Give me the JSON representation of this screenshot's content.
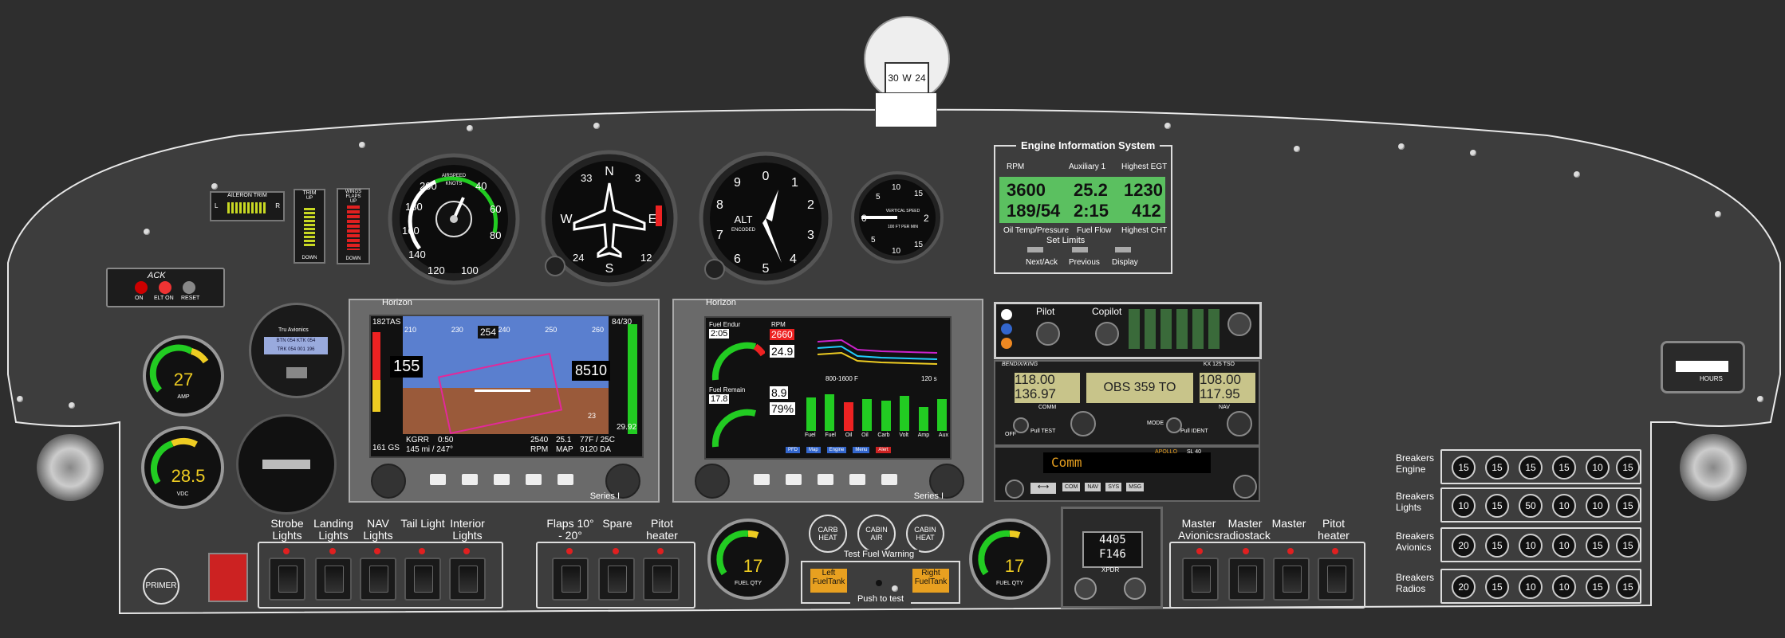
{
  "compass": {
    "labels": [
      "30",
      "W",
      "24"
    ]
  },
  "trim": {
    "aileron_label": "AILERON TRIM",
    "aileron_left": "L",
    "aileron_right": "R",
    "trim_label": "TRIM",
    "trim_up": "UP",
    "trim_down": "DOWN",
    "flaps_label": "WINGS FLAPS",
    "flaps_up": "UP",
    "flaps_down": "DOWN"
  },
  "elt": {
    "title": "ACK",
    "on": "ON",
    "elt_on": "ELT ON",
    "reset": "RESET"
  },
  "gauges": {
    "amp": {
      "value": "27",
      "label": "AMP"
    },
    "vdc": {
      "value": "28.5",
      "label": "VDC"
    },
    "airspeed": {
      "title": "AIRSPEED",
      "unit": "KNOTS",
      "ticks": [
        "200",
        "40",
        "180",
        "60",
        "160",
        "80",
        "140",
        "120",
        "100"
      ]
    },
    "heading": {
      "ticks": [
        "N",
        "33",
        "3",
        "E",
        "12",
        "S",
        "24",
        "W"
      ]
    },
    "altimeter": {
      "title": "ALT",
      "sub": "ENCODED",
      "ticks": [
        "0",
        "1",
        "2",
        "3",
        "4",
        "5",
        "6",
        "7",
        "8",
        "9"
      ]
    },
    "vsi": {
      "title": "VERTICAL SPEED",
      "unit": "100 FT PER MIN",
      "ticks": [
        "5",
        "10",
        "15",
        "2",
        "15",
        "10",
        "5",
        "0"
      ]
    },
    "fuel_left": {
      "value": "17",
      "label": "FUEL QTY"
    },
    "fuel_right": {
      "value": "17",
      "label": "FUEL QTY"
    }
  },
  "eis": {
    "title": "Engine Information System",
    "headers": [
      "RPM",
      "Auxiliary 1",
      "Highest EGT"
    ],
    "row1": [
      "3600",
      "25.2",
      "1230"
    ],
    "row2": [
      "189/54",
      "2:15",
      "412"
    ],
    "footers": [
      "Oil Temp/Pressure",
      "Fuel Flow",
      "Highest CHT"
    ],
    "set_limits": "Set Limits",
    "buttons": [
      "Next/Ack",
      "Previous",
      "Display"
    ]
  },
  "autopilot": {
    "title": "Tru Avionics",
    "l1": "BTN 054 KTK 054",
    "l2": "TRK 054 001 196"
  },
  "efis_left": {
    "brand": "Horizon",
    "series": "Series I",
    "tas": "182TAS",
    "baro": "84/30",
    "speed": "155",
    "heading": "254",
    "alt": "8510",
    "speeds": [
      "210",
      "230",
      "240",
      "250",
      "260"
    ],
    "gs": "161 GS",
    "airport": "KGRR",
    "time": "0:50",
    "dist": "145 mi / 247°",
    "rpm": "2540",
    "rpm_label": "RPM",
    "map": "25.1",
    "map_label": "MAP",
    "oat": "77F / 25C",
    "da": "9120 DA",
    "alt_setting": "29.92",
    "vs": "23"
  },
  "efis_right": {
    "brand": "Horizon",
    "series": "Series I",
    "fuel_endur_label": "Fuel Endur",
    "fuel_endur": "2:05",
    "rpm_label": "RPM",
    "rpm": "2660",
    "map": "24.9",
    "fuel_remain_label": "Fuel Remain",
    "fuel_remain": "17.8",
    "fuel_flow": "8.9",
    "pct": "79%",
    "range": "800-1600 F",
    "time": "120 s",
    "bars": [
      "Fuel",
      "Fuel",
      "Oil",
      "Oil",
      "Carb",
      "Volt",
      "Amp",
      "Aux"
    ],
    "tabs": [
      "PFD",
      "Map",
      "Engine",
      "Menu",
      "Alert"
    ]
  },
  "audio": {
    "pilot": "Pilot",
    "copilot": "Copilot"
  },
  "nav_comm": {
    "brand": "BENDIX/KING",
    "model": "KX 125 TSO",
    "comm_active": "118.00",
    "comm_standby": "136.97",
    "obs": "OBS 359 TO",
    "nav_active": "108.00",
    "nav_standby": "117.95",
    "comm": "COMM",
    "nav": "NAV",
    "mode": "MODE",
    "off": "OFF",
    "test": "Pull TEST",
    "ident": "Pull IDENT"
  },
  "apollo": {
    "display": "Comm",
    "brand": "APOLLO",
    "model": "SL 40",
    "buttons": [
      "COM",
      "NAV",
      "SYS",
      "MSG"
    ]
  },
  "xpdr": {
    "code": "4405",
    "alt": "F146",
    "label": "XPDR"
  },
  "hobbs": {
    "label": "HOURS"
  },
  "switches": {
    "group1": [
      "Strobe Lights",
      "Landing Lights",
      "NAV Lights",
      "Tail Light",
      "Interior Lights"
    ],
    "group2": [
      "Flaps 10° - 20°",
      "Spare",
      "Pitot heater"
    ],
    "group3": [
      "Master Avionics",
      "Master radiostack",
      "Master",
      "Pitot heater"
    ]
  },
  "carb": [
    "CARB HEAT",
    "CABIN AIR",
    "CABIN HEAT"
  ],
  "fuel_warning": {
    "title": "Test Fuel Warning",
    "left": "Left FuelTank",
    "right": "Right FuelTank",
    "push": "Push to test"
  },
  "primer": "PRIMER",
  "breakers": [
    {
      "label": "Breakers Engine",
      "values": [
        "15",
        "15",
        "15",
        "15",
        "10",
        "15"
      ]
    },
    {
      "label": "Breakers Lights",
      "values": [
        "10",
        "15",
        "50",
        "10",
        "10",
        "15"
      ]
    },
    {
      "label": "Breakers Avionics",
      "values": [
        "20",
        "15",
        "10",
        "10",
        "15",
        "15"
      ]
    },
    {
      "label": "Breakers Radios",
      "values": [
        "20",
        "15",
        "10",
        "10",
        "15",
        "15"
      ]
    }
  ]
}
